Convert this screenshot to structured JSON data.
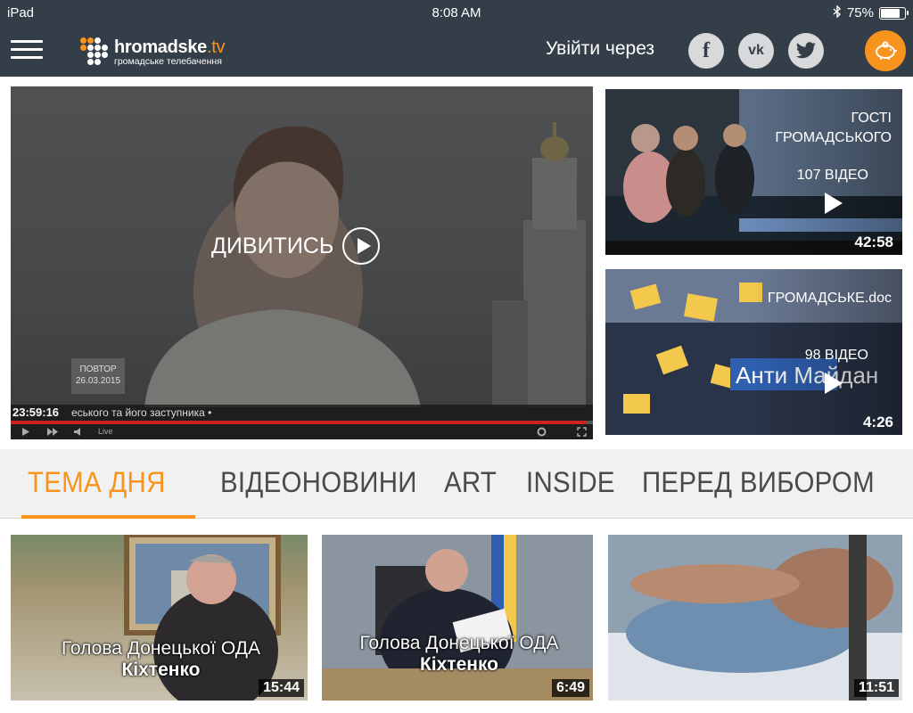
{
  "status_bar": {
    "device": "iPad",
    "time": "8:08 AM",
    "battery": "75%",
    "battery_level": 0.75
  },
  "header": {
    "logo_main": "hromadske",
    "logo_tv": ".tv",
    "logo_sub": "громадське телебачення",
    "login_label": "Увійти через",
    "social": {
      "facebook": "f",
      "vk": "vk",
      "twitter": "twitter-icon"
    },
    "colors": {
      "bar": "#343e48",
      "accent": "#f7941d"
    }
  },
  "hero": {
    "watch_label": "ДИВИТИСЬ",
    "replay_label": "ПОВТОР",
    "replay_date": "26.03.2015",
    "clock": "23:59:16",
    "ticker": "еського та його заступника •",
    "live_label": "Live"
  },
  "side_videos": [
    {
      "title": "ГОСТІ ГРОМАДСЬКОГО",
      "count": "107 ВІДЕО",
      "duration": "42:58"
    },
    {
      "title": "ГРОМАДСЬКЕ.doc",
      "count": "98 ВІДЕО",
      "duration": "4:26"
    }
  ],
  "tabs": [
    {
      "label": "ТЕМА ДНЯ",
      "active": true
    },
    {
      "label": "ВІДЕОНОВИНИ",
      "active": false
    },
    {
      "label": "ART",
      "active": false
    },
    {
      "label": "INSIDE",
      "active": false
    },
    {
      "label": "ПЕРЕД ВИБОРОМ",
      "active": false
    }
  ],
  "cards": [
    {
      "line1": "Голова Донецької ОДА",
      "line2": "Кіхтенко",
      "duration": "15:44"
    },
    {
      "line1": "Голова Донецької ОДА",
      "line2": "Кіхтенко",
      "duration": "6:49"
    },
    {
      "line1": "",
      "line2": "",
      "duration": "11:51"
    }
  ]
}
